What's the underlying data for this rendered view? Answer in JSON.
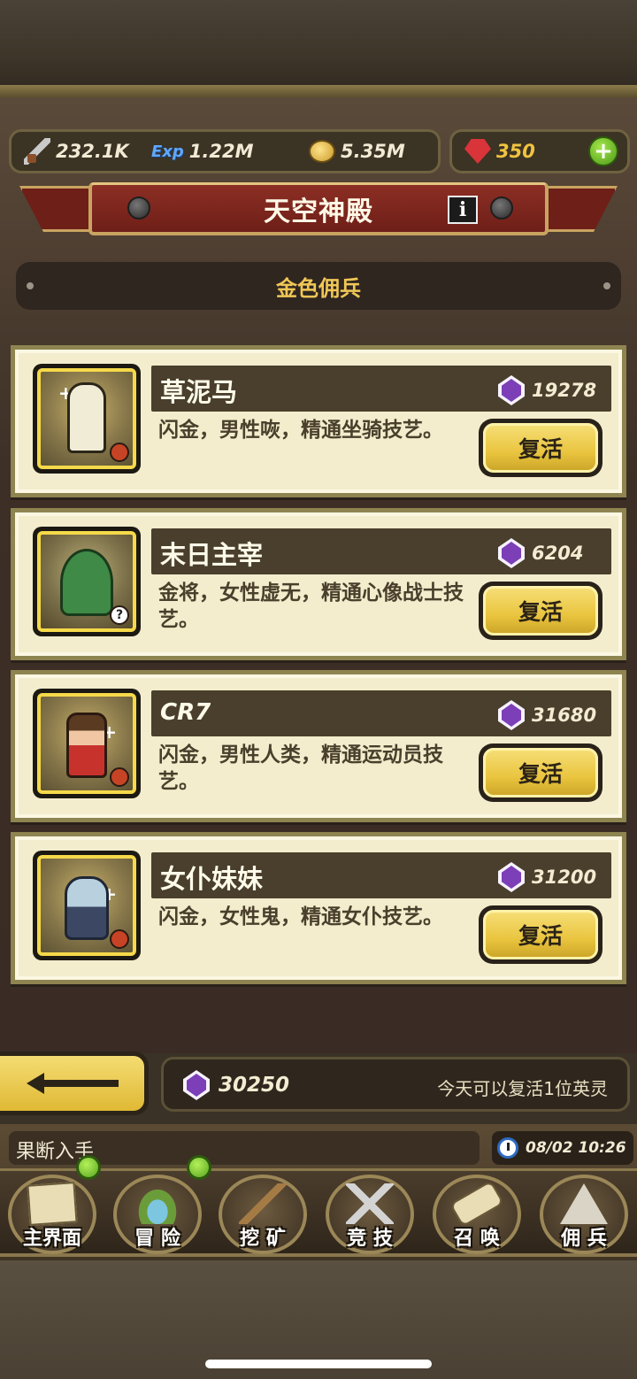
{
  "resources": {
    "power": "232.1K",
    "exp_label": "Exp",
    "exp": "1.22M",
    "gold": "5.35M",
    "rubies": "350",
    "add_label": "+"
  },
  "header": {
    "title": "天空神殿",
    "info_label": "i",
    "subtitle": "金色佣兵"
  },
  "heroes": [
    {
      "name": "草泥马",
      "cost": "19278",
      "description": "闪金，男性咴，精通坐骑技艺。",
      "action": "复活"
    },
    {
      "name": "末日主宰",
      "cost": "6204",
      "description": "金将，女性虚无，精通心像战士技艺。",
      "action": "复活",
      "badge": "?"
    },
    {
      "name": "CR7",
      "cost": "31680",
      "description": "闪金，男性人类，精通运动员技艺。",
      "action": "复活"
    },
    {
      "name": "女仆妹妹",
      "cost": "31200",
      "description": "闪金，女性鬼，精通女仆技艺。",
      "action": "复活"
    }
  ],
  "footer": {
    "total_gems": "30250",
    "revive_note": "今天可以复活1位英灵"
  },
  "ticker": {
    "text": "果断入手",
    "datetime": "08/02 10:26"
  },
  "nav": [
    {
      "label": "主界面",
      "notify": true
    },
    {
      "label": "冒 险",
      "notify": true
    },
    {
      "label": "挖 矿",
      "notify": false
    },
    {
      "label": "竞 技",
      "notify": false
    },
    {
      "label": "召 唤",
      "notify": false
    },
    {
      "label": "佣 兵",
      "notify": false
    }
  ],
  "colors": {
    "banner": "#8c2e24",
    "accent_gold": "#f0c756",
    "card_bg": "#f3edcd",
    "button_gold": "#e9c43e"
  }
}
